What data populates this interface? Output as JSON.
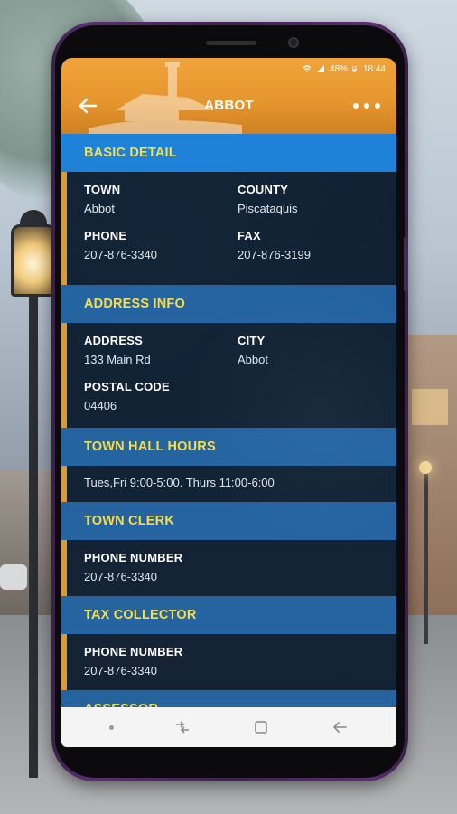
{
  "status_bar": {
    "battery": "48%",
    "time": "18:44",
    "icons": [
      "wifi-icon",
      "signal-icon",
      "battery-icon"
    ]
  },
  "app_bar": {
    "title": "ABBOT"
  },
  "sections": {
    "basic_detail": {
      "title": "BASIC DETAIL",
      "town_label": "TOWN",
      "town_value": "Abbot",
      "county_label": "COUNTY",
      "county_value": "Piscataquis",
      "phone_label": "PHONE",
      "phone_value": "207-876-3340",
      "fax_label": "FAX",
      "fax_value": "207-876-3199"
    },
    "address_info": {
      "title": "ADDRESS INFO",
      "address_label": "ADDRESS",
      "address_value": "133 Main Rd",
      "city_label": "CITY",
      "city_value": "Abbot",
      "postal_label": "POSTAL CODE",
      "postal_value": "04406"
    },
    "town_hall_hours": {
      "title": "TOWN HALL HOURS",
      "value": "Tues,Fri 9:00-5:00. Thurs 11:00-6:00"
    },
    "town_clerk": {
      "title": "TOWN CLERK",
      "phone_label": "PHONE NUMBER",
      "phone_value": "207-876-3340"
    },
    "tax_collector": {
      "title": "TAX COLLECTOR",
      "phone_label": "PHONE NUMBER",
      "phone_value": "207-876-3340"
    },
    "assessor": {
      "title": "ASSESSOR"
    }
  },
  "colors": {
    "app_bar": "#e5952d",
    "section_header_text": "#f6dd4c",
    "section_header_bg": "#1e82d8",
    "card_accent": "#d99a3c",
    "phone_frame": "#5b2f70"
  }
}
